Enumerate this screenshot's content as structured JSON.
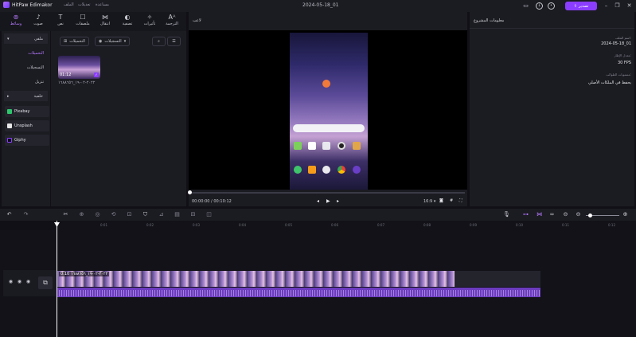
{
  "app": {
    "name": "HitPaw Edimakor",
    "project_date": "2024-05-18_01"
  },
  "menu": [
    "الملف",
    "تعديلات",
    "مساعدة"
  ],
  "export_label": "تصدير",
  "toolbar": [
    {
      "label": "وسائط",
      "icon": "media-icon",
      "active": true
    },
    {
      "label": "صوت",
      "icon": "music-icon"
    },
    {
      "label": "نص",
      "icon": "text-icon"
    },
    {
      "label": "ملصقات",
      "icon": "sticker-icon"
    },
    {
      "label": "انتقال",
      "icon": "transition-icon"
    },
    {
      "label": "تصفية",
      "icon": "filter-icon"
    },
    {
      "label": "تأثيرات",
      "icon": "effects-icon"
    },
    {
      "label": "الترجمة",
      "icon": "subtitle-icon"
    }
  ],
  "leftnav": {
    "local": "ملفي",
    "items": [
      "التحميلات",
      "التسجيلات",
      "تنزيل"
    ],
    "background": "خلفية",
    "sources": [
      {
        "label": "Pixabay",
        "color": "#2ec66d"
      },
      {
        "label": "Unsplash",
        "color": "#e8e8e8"
      },
      {
        "label": "Giphy",
        "color": "#11111a"
      }
    ]
  },
  "media": {
    "import_label": "التحميلات",
    "record_label": "التسجيلات",
    "clip": {
      "duration": "01:12",
      "name": "٢٠٢٢-٠٢-١٩_١٦٨٨٦٥٦"
    }
  },
  "preview": {
    "label": "لاعب",
    "time_current": "00:00:00",
    "time_total": "00:10:12",
    "aspect": "16:9"
  },
  "project_info": {
    "title": "معلومات المشروع",
    "fields": [
      {
        "label": "اسم الملف:",
        "value": "2024-05-18_01"
      },
      {
        "label": "معدل الإطار:",
        "value": "30 FPS"
      },
      {
        "label": "مستويات الطوالب:",
        "value": "يحفظ في الملكات الأصلي"
      }
    ]
  },
  "timeline": {
    "ticks": [
      "0:01",
      "0:02",
      "0:03",
      "0:04",
      "0:05",
      "0:06",
      "0:07",
      "0:08",
      "0:09",
      "0:10",
      "0:11",
      "0:12"
    ],
    "clip_label": "0:10 ٢٠٢٢-٠٢-١٩_١٦٨٨٦٥٦"
  }
}
